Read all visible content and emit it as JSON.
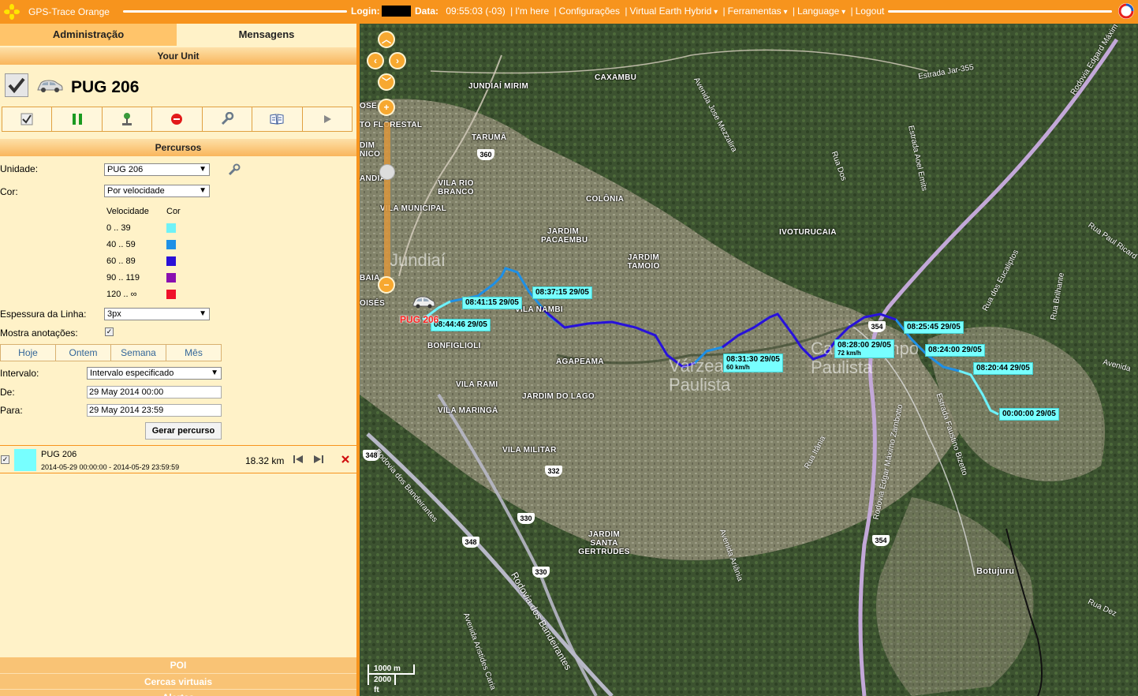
{
  "topbar": {
    "app_title": "GPS-Trace Orange",
    "login_label": "Login:",
    "data_label": "Data:",
    "data_value": "09:55:03 (-03)",
    "menu": [
      "I'm here",
      "Configurações",
      "Virtual Earth Hybrid",
      "Ferramentas",
      "Language",
      "Logout"
    ],
    "colors": {
      "bar": "#f7941d"
    }
  },
  "tabs": {
    "admin": "Administração",
    "messages": "Mensagens"
  },
  "unit_section": {
    "title": "Your Unit",
    "unit_name": "PUG 206"
  },
  "toolbar_icons": [
    "check-icon",
    "pause-icon",
    "locate-icon",
    "stop-icon",
    "wrench-icon",
    "book-icon",
    "play-icon"
  ],
  "routes": {
    "title": "Percursos",
    "unit_label": "Unidade:",
    "unit_value": "PUG 206",
    "color_label": "Cor:",
    "color_value": "Por velocidade",
    "legend_speed": "Velocidade",
    "legend_color": "Cor",
    "legend": [
      {
        "range": "0 .. 39",
        "color": "#6ff2f7"
      },
      {
        "range": "40 .. 59",
        "color": "#1e90e6"
      },
      {
        "range": "60 .. 89",
        "color": "#2a10d8"
      },
      {
        "range": "90 .. 119",
        "color": "#8a10b0"
      },
      {
        "range": "120 .. ∞",
        "color": "#f0102a"
      }
    ],
    "line_width_label": "Espessura da Linha:",
    "line_width_value": "3px",
    "show_notes_label": "Mostra anotações:",
    "periods": [
      "Hoje",
      "Ontem",
      "Semana",
      "Mês"
    ],
    "interval_label": "Intervalo:",
    "interval_value": "Intervalo especificado",
    "from_label": "De:",
    "from_value": "29 May 2014 00:00",
    "to_label": "Para:",
    "to_value": "29 May 2014 23:59",
    "generate_button": "Gerar percurso"
  },
  "route_entry": {
    "name": "PUG 206",
    "dates": "2014-05-29 00:00:00 - 2014-05-29 23:59:59",
    "distance": "18.32 km"
  },
  "bottom": {
    "poi": "POI",
    "geofences": "Cercas virtuais",
    "alerts": "Alertas"
  },
  "map": {
    "place_labels": [
      "JUNDIAÍ MIRIM",
      "CAXAMBU",
      "TARUMÃ",
      "VILA RIO BRANCO",
      "COLÔNIA",
      "VILA MUNICIPAL",
      "JARDIM PACAEMBU",
      "JARDIM TAMOIO",
      "IVOTURUCAIA",
      "VILA NAMBI",
      "BONFIGLIOLI",
      "AGAPEAMA",
      "VILA RAMI",
      "JARDIM DO LAGO",
      "VILA MARINGÁ",
      "VILA MILITAR",
      "JARDIM SANTA GERTRUDES",
      "Botujuru",
      "TO FLORESTAL",
      "DIM NICO",
      "ANDIA",
      "BAIA",
      "OISÉS",
      "OSE"
    ],
    "city_labels": [
      "Jundiaí",
      "Várzea Paulista",
      "Campo Limpo Paulista"
    ],
    "road_shields": [
      "360",
      "354",
      "348",
      "332",
      "330",
      "348",
      "330",
      "354"
    ],
    "road_names": [
      "Estrada Jar-355",
      "Avenida Jose Mezzalira",
      "Estrada Aoel Emits",
      "Rua Dos",
      "Rodovia Edgard Máxim",
      "Rua Paul Ricard",
      "Rua dos Eucaliptos",
      "Rua Brilhante",
      "Avenida",
      "Rodovia Edgar Máximo Zambotto",
      "Estrada Faustino Bizetto",
      "Rua Itânia",
      "Avenida Ariânia",
      "Rodovia dos Bandeirantes",
      "Rodovia dos Bandeirantes",
      "Avenida Aristides Caria",
      "Rua Dez"
    ],
    "time_tags": [
      {
        "time": "08:37:15 29/05"
      },
      {
        "time": "08:41:15 29/05"
      },
      {
        "time": "08:44:46 29/05"
      },
      {
        "time": "08:31:30 29/05",
        "speed": "60 km/h"
      },
      {
        "time": "08:28:00 29/05",
        "speed": "72 km/h"
      },
      {
        "time": "08:25:45 29/05"
      },
      {
        "time": "08:24:00 29/05"
      },
      {
        "time": "08:20:44 29/05"
      },
      {
        "time": "00:00:00 29/05"
      }
    ],
    "car_label": "PUG 206",
    "scale": [
      "1000 m",
      "2000 ft"
    ]
  }
}
